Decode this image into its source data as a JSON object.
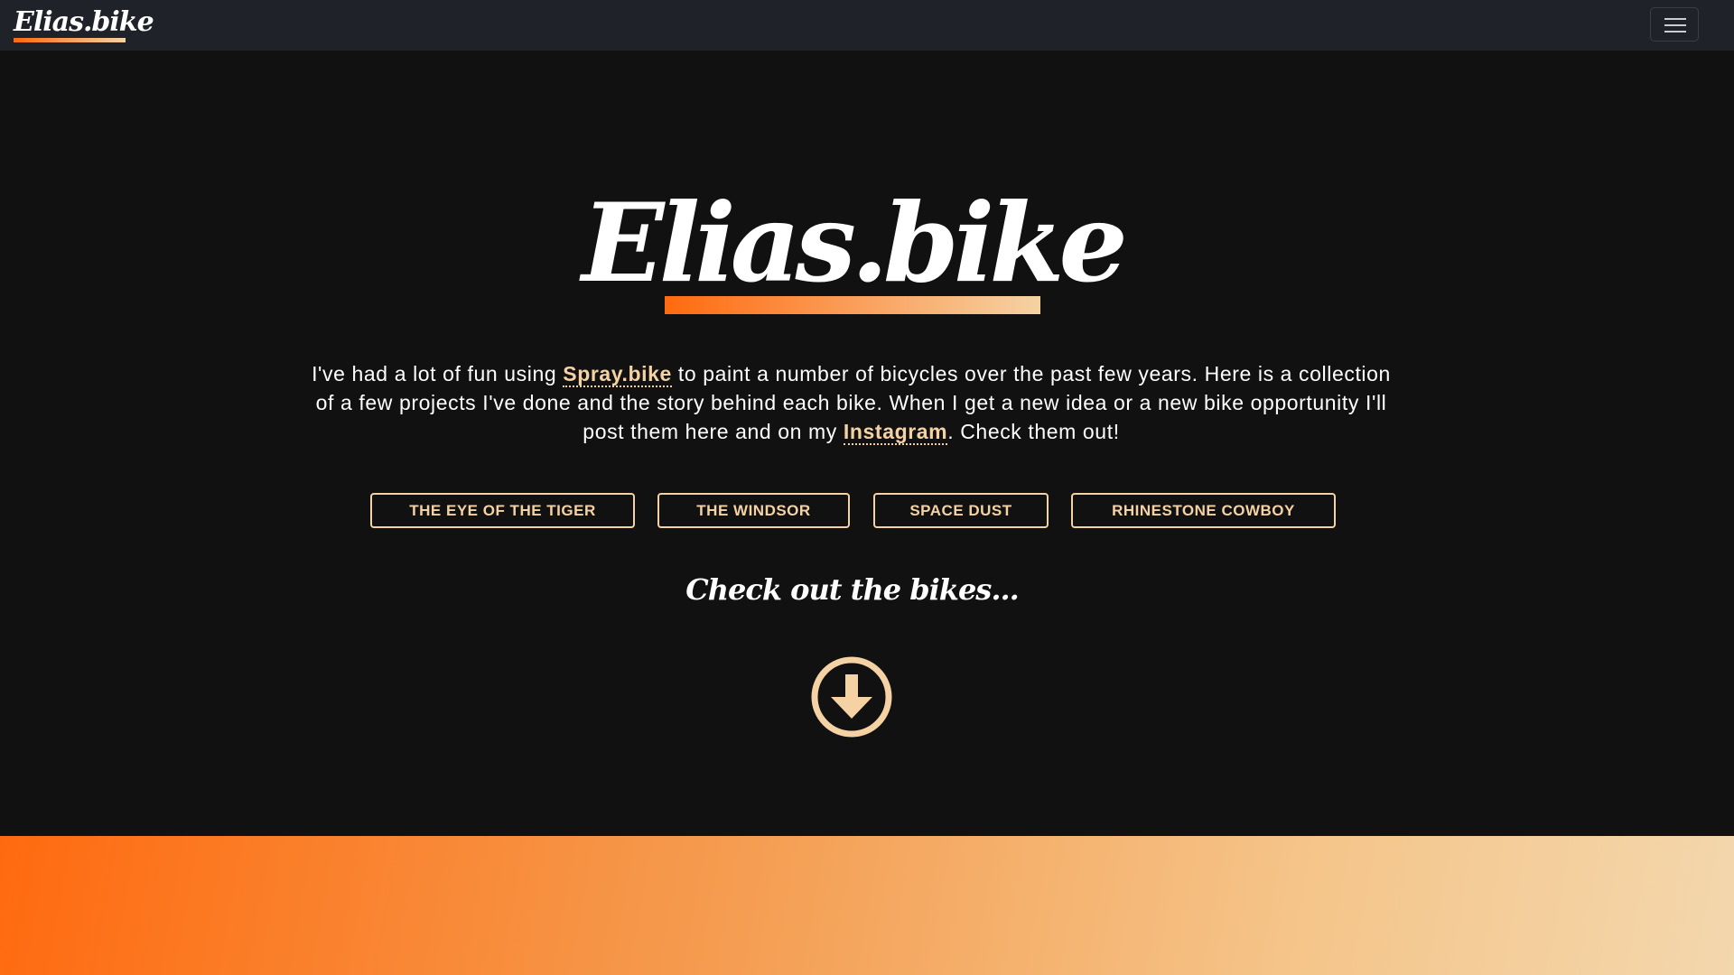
{
  "navbar": {
    "brand": "Elias.bike",
    "menu_icon": "hamburger-menu-icon"
  },
  "hero": {
    "title": "Elias.bike",
    "intro_part1": "I've had a lot of fun using ",
    "spray_link": "Spray.bike",
    "intro_part2": " to paint a number of bicycles over the past few years. Here is a collection of a few projects I've done and the story behind each bike. When I get a new idea or a new bike opportunity I'll post them here and on my ",
    "instagram_link": "Instagram",
    "intro_part3": ". Check them out!"
  },
  "bikes": [
    {
      "label": "THE EYE OF THE TIGER"
    },
    {
      "label": "THE WINDSOR"
    },
    {
      "label": "SPACE DUST"
    },
    {
      "label": "RHINESTONE COWBOY"
    }
  ],
  "cta": {
    "text": "Check out the bikes...",
    "icon": "arrow-circle-down-icon"
  },
  "colors": {
    "background": "#111111",
    "navbar": "#1f2329",
    "accent_light": "#f5d2a3",
    "accent_orange": "#ff6a0f"
  }
}
